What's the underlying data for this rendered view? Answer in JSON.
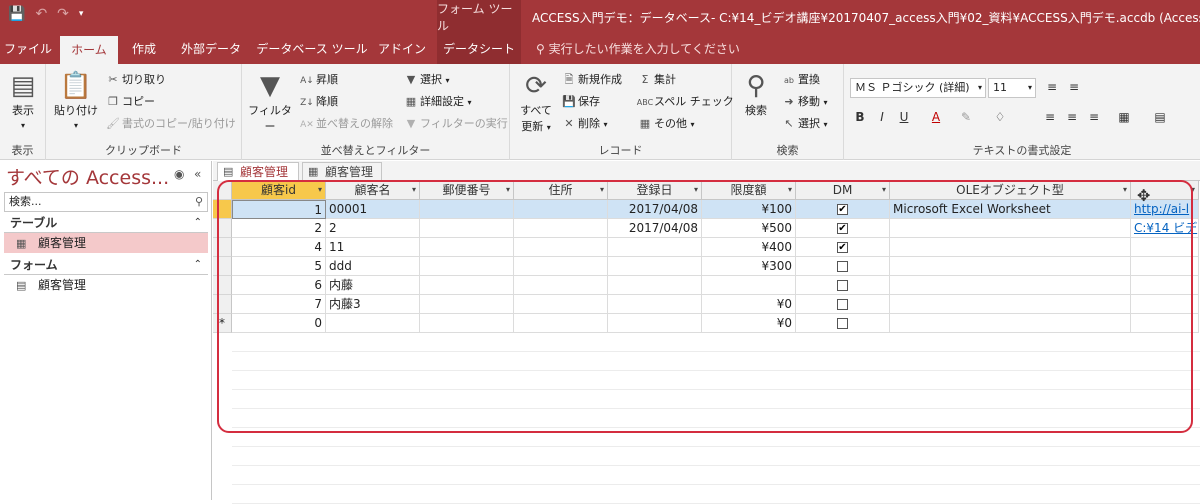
{
  "titlebar": {
    "context_tools": "フォーム ツール",
    "window_title": "ACCESS入門デモ：データベース- C:¥14_ビデオ講座¥20170407_access入門¥02_資料¥ACCESS入門デモ.accdb (Access 2007 - 2016"
  },
  "tabs": [
    {
      "label": "ファイル"
    },
    {
      "label": "ホーム"
    },
    {
      "label": "作成"
    },
    {
      "label": "外部データ"
    },
    {
      "label": "データベース ツール"
    },
    {
      "label": "アドイン"
    },
    {
      "label": "データシート"
    }
  ],
  "tell_me": "実行したい作業を入力してください",
  "ribbon": {
    "view": {
      "button": "表示",
      "label": "表示"
    },
    "clipboard": {
      "paste": "貼り付け",
      "cut": "切り取り",
      "copy": "コピー",
      "format_painter": "書式のコピー/貼り付け",
      "label": "クリップボード"
    },
    "sort_filter": {
      "filter": "フィルター",
      "asc": "昇順",
      "desc": "降順",
      "clear_sort": "並べ替えの解除",
      "selection": "選択",
      "advanced": "詳細設定",
      "toggle_filter": "フィルターの実行",
      "label": "並べ替えとフィルター"
    },
    "records": {
      "refresh_line1": "すべて",
      "refresh_line2": "更新",
      "new": "新規作成",
      "save": "保存",
      "delete": "削除",
      "totals": "集計",
      "spelling": "スペル チェック",
      "more": "その他",
      "label": "レコード"
    },
    "find": {
      "find": "検索",
      "replace": "置換",
      "goto": "移動",
      "select": "選択",
      "label": "検索"
    },
    "text": {
      "font": "ＭＳ Ｐゴシック (詳細)",
      "size": "11",
      "label": "テキストの書式設定"
    }
  },
  "nav": {
    "header": "すべての Access...",
    "search_placeholder": "検索...",
    "sections": [
      {
        "title": "テーブル",
        "items": [
          "顧客管理"
        ]
      },
      {
        "title": "フォーム",
        "items": [
          "顧客管理"
        ]
      }
    ]
  },
  "doc_tabs": [
    {
      "label": "顧客管理"
    },
    {
      "label": "顧客管理"
    }
  ],
  "grid": {
    "columns": [
      "顧客id",
      "顧客名",
      "郵便番号",
      "住所",
      "登録日",
      "限度額",
      "DM",
      "OLEオブジェクト型",
      ""
    ],
    "rows": [
      {
        "id": "1",
        "name": "00001",
        "zip": "",
        "addr": "",
        "date": "2017/04/08",
        "limit": "¥100",
        "dm": true,
        "ole": "Microsoft Excel Worksheet",
        "link": "http://ai-l"
      },
      {
        "id": "2",
        "name": "2",
        "zip": "",
        "addr": "",
        "date": "2017/04/08",
        "limit": "¥500",
        "dm": true,
        "ole": "",
        "link": "C:¥14 ビデ"
      },
      {
        "id": "4",
        "name": "11",
        "zip": "",
        "addr": "",
        "date": "",
        "limit": "¥400",
        "dm": true,
        "ole": "",
        "link": ""
      },
      {
        "id": "5",
        "name": "ddd",
        "zip": "",
        "addr": "",
        "date": "",
        "limit": "¥300",
        "dm": false,
        "ole": "",
        "link": ""
      },
      {
        "id": "6",
        "name": "内藤",
        "zip": "",
        "addr": "",
        "date": "",
        "limit": "",
        "dm": false,
        "ole": "",
        "link": ""
      },
      {
        "id": "7",
        "name": "内藤3",
        "zip": "",
        "addr": "",
        "date": "",
        "limit": "¥0",
        "dm": false,
        "ole": "",
        "link": ""
      },
      {
        "id": "0",
        "name": "",
        "zip": "",
        "addr": "",
        "date": "",
        "limit": "¥0",
        "dm": false,
        "ole": "",
        "link": ""
      }
    ],
    "new_row_marker": "*"
  },
  "colors": {
    "accent": "#a4373a",
    "highlight_row": "#cfe3f5",
    "selected_header": "#f7c84b",
    "annotation": "#d42d3f"
  }
}
